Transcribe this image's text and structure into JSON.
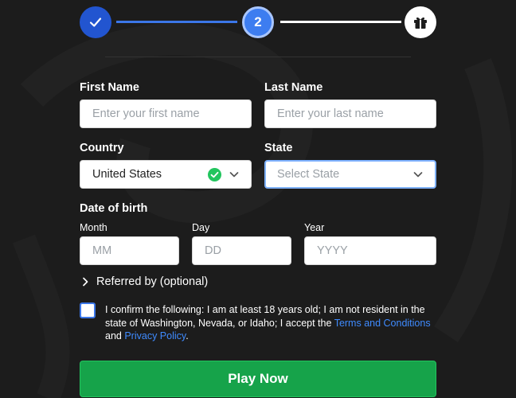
{
  "stepper": {
    "current_step": "2",
    "step1_icon": "check-icon",
    "step3_icon": "gift-icon"
  },
  "form": {
    "first_name": {
      "label": "First Name",
      "placeholder": "Enter your first name",
      "value": ""
    },
    "last_name": {
      "label": "Last Name",
      "placeholder": "Enter your last name",
      "value": ""
    },
    "country": {
      "label": "Country",
      "value": "United States"
    },
    "state": {
      "label": "State",
      "placeholder": "Select State"
    },
    "dob": {
      "label": "Date of birth",
      "month": {
        "label": "Month",
        "placeholder": "MM"
      },
      "day": {
        "label": "Day",
        "placeholder": "DD"
      },
      "year": {
        "label": "Year",
        "placeholder": "YYYY"
      }
    },
    "referred": {
      "label": "Referred by (optional)"
    },
    "consent": {
      "text_before": "I confirm the following: I am at least 18 years old; I am not resident in the state of Washington, Nevada, or Idaho; I accept the ",
      "terms_link": "Terms and Conditions",
      "and": " and ",
      "privacy_link": "Privacy Policy",
      "period": "."
    },
    "submit_label": "Play Now"
  },
  "colors": {
    "background": "#1c1c1c",
    "primary_blue": "#3b76e8",
    "link_blue": "#3f8bff",
    "play_green": "#16a34a",
    "valid_green": "#22c55e"
  }
}
